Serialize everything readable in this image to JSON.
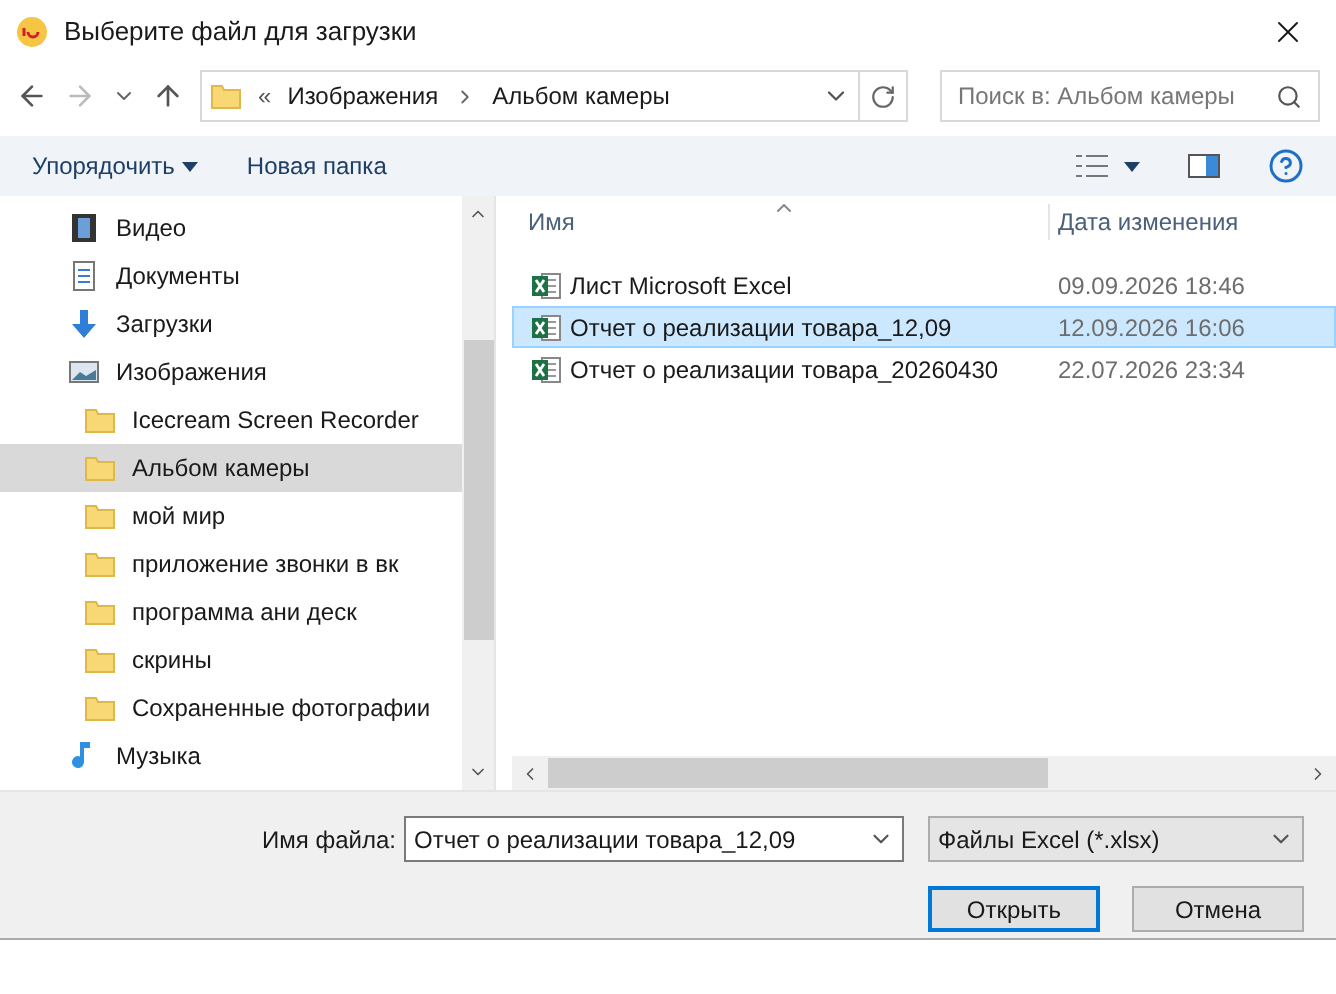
{
  "window": {
    "title": "Выберите файл для загрузки"
  },
  "address": {
    "prefix": "«",
    "crumbs": [
      "Изображения",
      "Альбом камеры"
    ],
    "search_placeholder": "Поиск в: Альбом камеры"
  },
  "toolbar": {
    "organize": "Упорядочить",
    "new_folder": "Новая папка"
  },
  "sidebar": {
    "items": [
      {
        "label": "Видео",
        "kind": "video",
        "selected": false
      },
      {
        "label": "Документы",
        "kind": "docs",
        "selected": false
      },
      {
        "label": "Загрузки",
        "kind": "downloads",
        "selected": false
      },
      {
        "label": "Изображения",
        "kind": "pictures",
        "selected": false,
        "children": [
          {
            "label": "Icecream Screen Recorder",
            "kind": "folder",
            "selected": false
          },
          {
            "label": "Альбом камеры",
            "kind": "folder",
            "selected": true
          },
          {
            "label": "мой мир",
            "kind": "folder",
            "selected": false
          },
          {
            "label": "приложение звонки в вк",
            "kind": "folder",
            "selected": false
          },
          {
            "label": "программа ани деск",
            "kind": "folder",
            "selected": false
          },
          {
            "label": "скрины",
            "kind": "folder",
            "selected": false
          },
          {
            "label": "Сохраненные фотографии",
            "kind": "folder",
            "selected": false
          }
        ]
      },
      {
        "label": "Музыка",
        "kind": "music",
        "selected": false
      }
    ]
  },
  "table": {
    "columns": [
      "Имя",
      "Дата изменения"
    ],
    "rows": [
      {
        "name": "Лист Microsoft Excel",
        "date": "09.09.2026 18:46",
        "selected": false
      },
      {
        "name": "Отчет о реализации товара_12,09",
        "date": "12.09.2026 16:06",
        "selected": true
      },
      {
        "name": "Отчет о реализации товара_20260430",
        "date": "22.07.2026 23:34",
        "selected": false
      }
    ]
  },
  "footer": {
    "filename_label": "Имя файла:",
    "filename": "Отчет о реализации товара_12,09",
    "filter": "Файлы Excel (*.xlsx)",
    "open": "Открыть",
    "cancel": "Отмена"
  }
}
